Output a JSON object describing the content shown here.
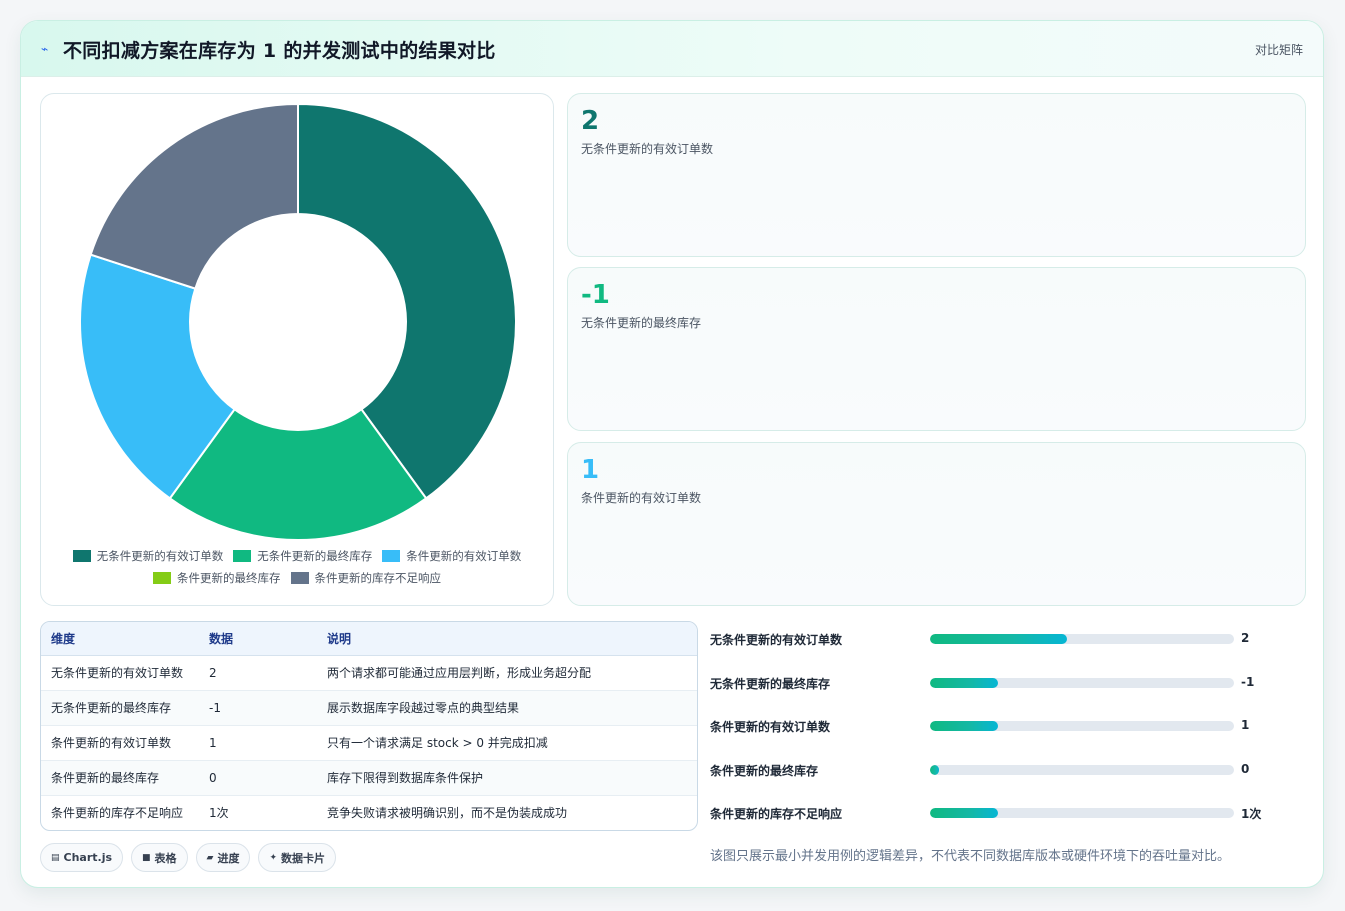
{
  "header": {
    "icon": "bolt-icon",
    "title": "不同扣减方案在库存为 1 的并发测试中的结果对比",
    "tag": "对比矩阵"
  },
  "chart_data": {
    "type": "pie",
    "categories": [
      "无条件更新的有效订单数",
      "无条件更新的最终库存",
      "条件更新的有效订单数",
      "条件更新的最终库存",
      "条件更新的库存不足响应"
    ],
    "values": [
      2,
      1,
      1,
      0,
      1
    ],
    "colors": [
      "#0f766e",
      "#10b981",
      "#38bdf8",
      "#84cc16",
      "#64748b"
    ],
    "donut": true,
    "legend": "bottom"
  },
  "stats": [
    {
      "value": "2",
      "label": "无条件更新的有效订单数",
      "color": "#0f766e"
    },
    {
      "value": "-1",
      "label": "无条件更新的最终库存",
      "color": "#10b981"
    },
    {
      "value": "1",
      "label": "条件更新的有效订单数",
      "color": "#38bdf8"
    }
  ],
  "table": {
    "headers": [
      "维度",
      "数据",
      "说明"
    ],
    "rows": [
      [
        "无条件更新的有效订单数",
        "2",
        "两个请求都可能通过应用层判断，形成业务超分配"
      ],
      [
        "无条件更新的最终库存",
        "-1",
        "展示数据库字段越过零点的典型结果"
      ],
      [
        "条件更新的有效订单数",
        "1",
        "只有一个请求满足 stock > 0 并完成扣减"
      ],
      [
        "条件更新的最终库存",
        "0",
        "库存下限得到数据库条件保护"
      ],
      [
        "条件更新的库存不足响应",
        "1次",
        "竞争失败请求被明确识别，而不是伪装成成功"
      ]
    ]
  },
  "chips": [
    {
      "icon": "chart-icon",
      "label": "Chart.js"
    },
    {
      "icon": "table-icon",
      "label": "表格"
    },
    {
      "icon": "progress-icon",
      "label": "进度"
    },
    {
      "icon": "card-icon",
      "label": "数据卡片"
    }
  ],
  "bars": [
    {
      "label": "无条件更新的有效订单数",
      "display": "2",
      "fraction": 0.45
    },
    {
      "label": "无条件更新的最终库存",
      "display": "-1",
      "fraction": 0.225
    },
    {
      "label": "条件更新的有效订单数",
      "display": "1",
      "fraction": 0.225
    },
    {
      "label": "条件更新的最终库存",
      "display": "0",
      "fraction": 0.03
    },
    {
      "label": "条件更新的库存不足响应",
      "display": "1次",
      "fraction": 0.225
    }
  ],
  "footnote": "该图只展示最小并发用例的逻辑差异，不代表不同数据库版本或硬件环境下的吞吐量对比。"
}
